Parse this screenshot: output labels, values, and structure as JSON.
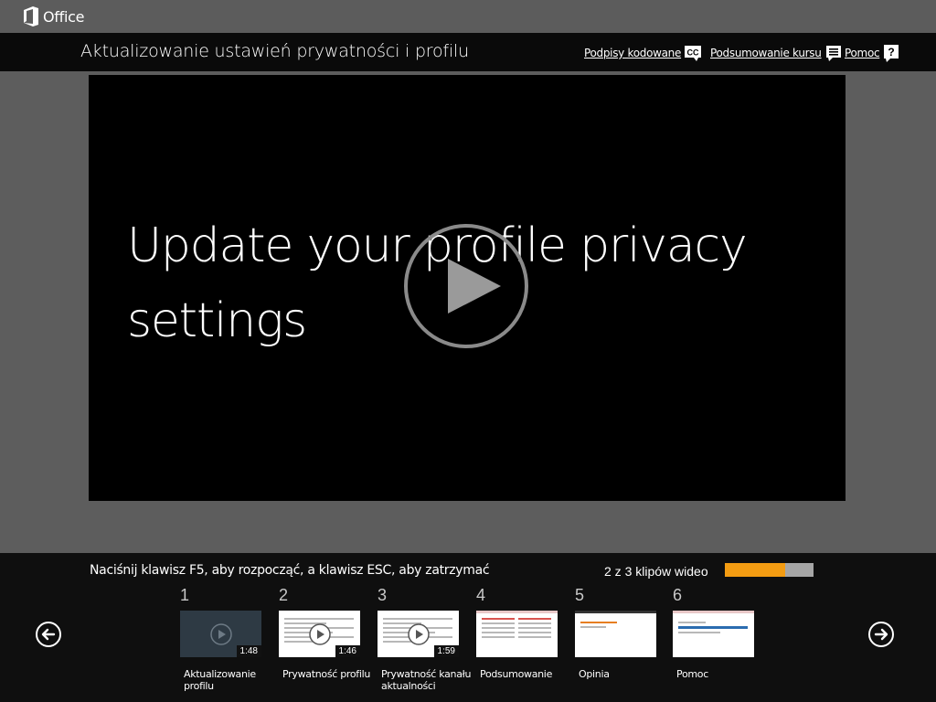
{
  "office_bar": {
    "brand": "Office"
  },
  "title_bar": {
    "course_title": "Aktualizowanie ustawień prywatności i profilu",
    "links": {
      "captions": "Podpisy kodowane",
      "captions_icon_text": "CC",
      "summary": "Podsumowanie kursu",
      "help": "Pomoc",
      "help_icon_text": "?"
    }
  },
  "video": {
    "slide_title": "Update your profile privacy settings"
  },
  "bottom": {
    "hint": "Naciśnij klawisz F5, aby rozpocząć, a klawisz ESC, aby zatrzymać",
    "clip_count": "2 z 3 klipów wideo",
    "progress_fraction": 0.68,
    "progress_color": "#f39c12",
    "thumbnails": [
      {
        "number": "1",
        "label": "Aktualizowanie profilu",
        "duration": "1:48"
      },
      {
        "number": "2",
        "label": "Prywatność profilu",
        "duration": "1:46"
      },
      {
        "number": "3",
        "label": "Prywatność kanału aktualności",
        "duration": "1:59"
      },
      {
        "number": "4",
        "label": "Podsumowanie",
        "duration": ""
      },
      {
        "number": "5",
        "label": "Opinia",
        "duration": ""
      },
      {
        "number": "6",
        "label": "Pomoc",
        "duration": ""
      }
    ]
  }
}
